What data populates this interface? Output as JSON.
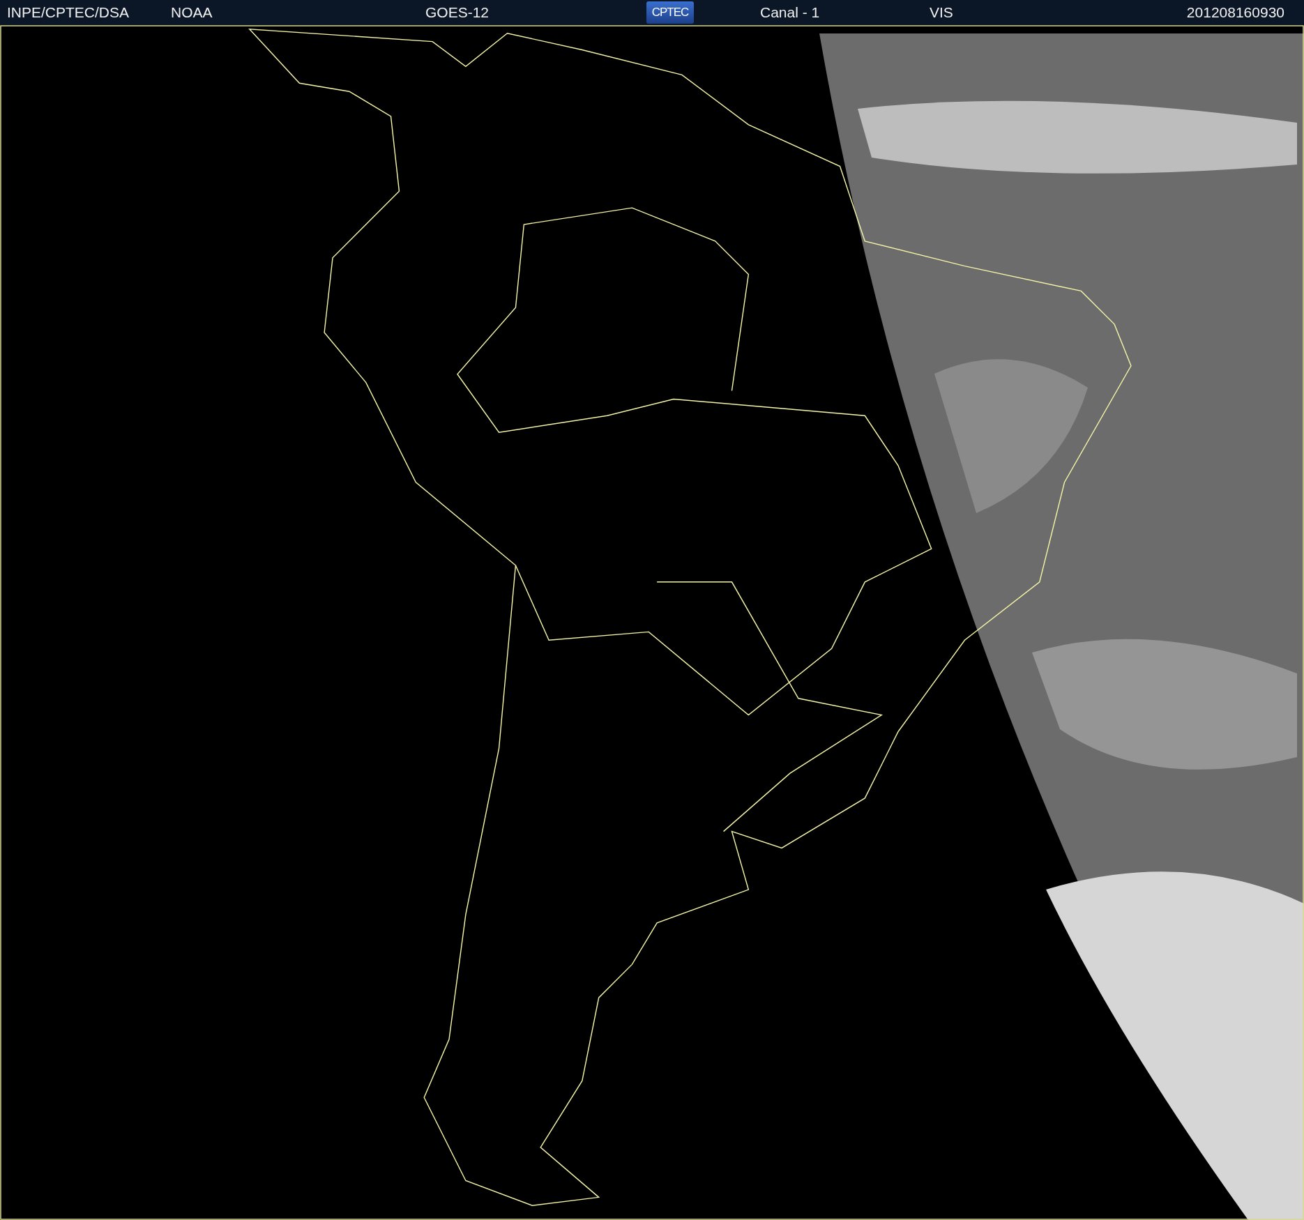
{
  "header": {
    "agency": "INPE/CPTEC/DSA",
    "source": "NOAA",
    "satellite": "GOES-12",
    "logo": "CPTEC",
    "channel": "Canal - 1",
    "band": "VIS",
    "timestamp": "201208160930"
  }
}
